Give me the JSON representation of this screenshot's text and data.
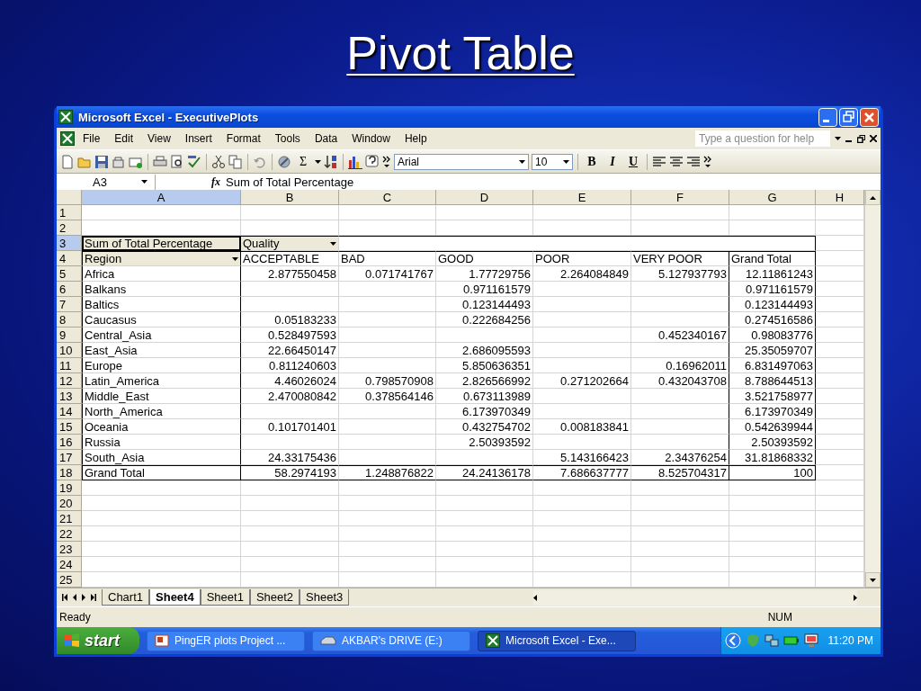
{
  "slide_title": "Pivot Table",
  "window": {
    "title": "Microsoft Excel - ExecutivePlots"
  },
  "menu": [
    "File",
    "Edit",
    "View",
    "Insert",
    "Format",
    "Tools",
    "Data",
    "Window",
    "Help"
  ],
  "help_search": {
    "placeholder": "Type a question for help"
  },
  "toolbar": {
    "autosum": "Σ",
    "font": "Arial",
    "font_size": "10",
    "bold": "B",
    "italic": "I",
    "underline": "U"
  },
  "formula_bar": {
    "name_box": "A3",
    "fx": "fx",
    "content": "Sum of Total Percentage"
  },
  "columns": [
    {
      "label": "A",
      "selected": true
    },
    {
      "label": "B",
      "selected": false
    },
    {
      "label": "C",
      "selected": false
    },
    {
      "label": "D",
      "selected": false
    },
    {
      "label": "E",
      "selected": false
    },
    {
      "label": "F",
      "selected": false
    },
    {
      "label": "G",
      "selected": false
    },
    {
      "label": "H",
      "selected": false
    }
  ],
  "rows": [
    {
      "label": "1",
      "selected": false,
      "kind": "blank",
      "cells": []
    },
    {
      "label": "2",
      "selected": false,
      "kind": "blank",
      "cells": []
    },
    {
      "label": "3",
      "selected": true,
      "kind": "pivot-field",
      "cells": [
        {
          "text": "Sum of Total Percentage",
          "kind": "field"
        },
        {
          "text": "Quality",
          "kind": "field-dropdown"
        }
      ]
    },
    {
      "label": "4",
      "selected": false,
      "kind": "pivot-header",
      "cells": [
        {
          "text": "Region",
          "kind": "field-dropdown"
        },
        "ACCEPTABLE",
        "BAD",
        "GOOD",
        "POOR",
        "VERY POOR",
        "Grand Total"
      ]
    },
    {
      "label": "5",
      "selected": false,
      "kind": "data",
      "cells": [
        "Africa",
        "2.877550458",
        "0.071741767",
        "1.77729756",
        "2.264084849",
        "5.127937793",
        "12.11861243"
      ]
    },
    {
      "label": "6",
      "selected": false,
      "kind": "data",
      "cells": [
        "Balkans",
        null,
        null,
        "0.971161579",
        null,
        null,
        "0.971161579"
      ]
    },
    {
      "label": "7",
      "selected": false,
      "kind": "data",
      "cells": [
        "Baltics",
        null,
        null,
        "0.123144493",
        null,
        null,
        "0.123144493"
      ]
    },
    {
      "label": "8",
      "selected": false,
      "kind": "data",
      "cells": [
        "Caucasus",
        "0.05183233",
        null,
        "0.222684256",
        null,
        null,
        "0.274516586"
      ]
    },
    {
      "label": "9",
      "selected": false,
      "kind": "data",
      "cells": [
        "Central_Asia",
        "0.528497593",
        null,
        null,
        null,
        "0.452340167",
        "0.98083776"
      ]
    },
    {
      "label": "10",
      "selected": false,
      "kind": "data",
      "cells": [
        "East_Asia",
        "22.66450147",
        null,
        "2.686095593",
        null,
        null,
        "25.35059707"
      ]
    },
    {
      "label": "11",
      "selected": false,
      "kind": "data",
      "cells": [
        "Europe",
        "0.811240603",
        null,
        "5.850636351",
        null,
        "0.16962011",
        "6.831497063"
      ]
    },
    {
      "label": "12",
      "selected": false,
      "kind": "data",
      "cells": [
        "Latin_America",
        "4.46026024",
        "0.798570908",
        "2.826566992",
        "0.271202664",
        "0.432043708",
        "8.788644513"
      ]
    },
    {
      "label": "13",
      "selected": false,
      "kind": "data",
      "cells": [
        "Middle_East",
        "2.470080842",
        "0.378564146",
        "0.673113989",
        null,
        null,
        "3.521758977"
      ]
    },
    {
      "label": "14",
      "selected": false,
      "kind": "data",
      "cells": [
        "North_America",
        null,
        null,
        "6.173970349",
        null,
        null,
        "6.173970349"
      ]
    },
    {
      "label": "15",
      "selected": false,
      "kind": "data",
      "cells": [
        "Oceania",
        "0.101701401",
        null,
        "0.432754702",
        "0.008183841",
        null,
        "0.542639944"
      ]
    },
    {
      "label": "16",
      "selected": false,
      "kind": "data",
      "cells": [
        "Russia",
        null,
        null,
        "2.50393592",
        null,
        null,
        "2.50393592"
      ]
    },
    {
      "label": "17",
      "selected": false,
      "kind": "data",
      "cells": [
        "South_Asia",
        "24.33175436",
        null,
        null,
        "5.143166423",
        "2.34376254",
        "31.81868332"
      ]
    },
    {
      "label": "18",
      "selected": false,
      "kind": "total",
      "cells": [
        "Grand Total",
        "58.2974193",
        "1.248876822",
        "24.24136178",
        "7.686637777",
        "8.525704317",
        "100"
      ]
    },
    {
      "label": "19",
      "selected": false,
      "kind": "blank",
      "cells": []
    },
    {
      "label": "20",
      "selected": false,
      "kind": "blank",
      "cells": []
    },
    {
      "label": "21",
      "selected": false,
      "kind": "blank",
      "cells": []
    },
    {
      "label": "22",
      "selected": false,
      "kind": "blank",
      "cells": []
    },
    {
      "label": "23",
      "selected": false,
      "kind": "blank",
      "cells": []
    },
    {
      "label": "24",
      "selected": false,
      "kind": "blank",
      "cells": []
    },
    {
      "label": "25",
      "selected": false,
      "kind": "blank",
      "cells": []
    }
  ],
  "sheet_tabs": [
    {
      "label": "Chart1",
      "selected": false
    },
    {
      "label": "Sheet4",
      "selected": true
    },
    {
      "label": "Sheet1",
      "selected": false
    },
    {
      "label": "Sheet2",
      "selected": false
    },
    {
      "label": "Sheet3",
      "selected": false
    }
  ],
  "status_bar": {
    "status": "Ready",
    "indicator": "NUM"
  },
  "taskbar": {
    "start": "start",
    "tasks": [
      {
        "label": "PingER plots Project ...",
        "kind": "slides",
        "selected": false
      },
      {
        "label": "AKBAR's DRIVE (E:)",
        "kind": "drive",
        "selected": false
      },
      {
        "label": "Microsoft Excel - Exe...",
        "kind": "excel",
        "selected": true
      }
    ],
    "clock": "11:20 PM"
  }
}
